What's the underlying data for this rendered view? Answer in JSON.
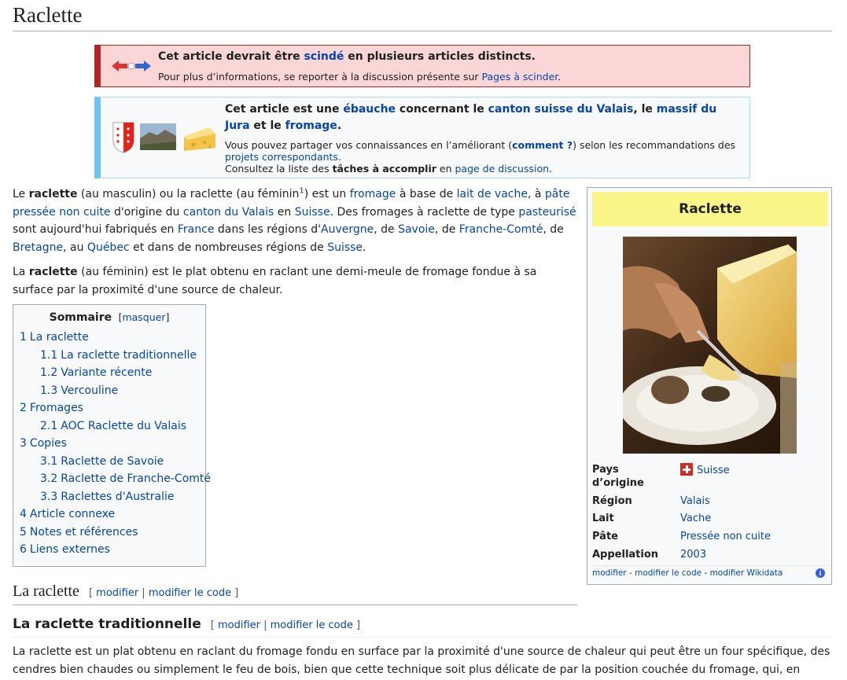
{
  "page": {
    "title": "Raclette"
  },
  "split_banner": {
    "title_pre": "Cet article devrait être ",
    "title_link": "scindé",
    "title_post": " en plusieurs articles distincts.",
    "info_pre": "Pour plus d’informations, se reporter à la discussion présente sur ",
    "info_link": "Pages à scinder",
    "info_post": "."
  },
  "stub_banner": {
    "h_pre": "Cet article est une ",
    "h_link1": "ébauche",
    "h_mid1": " concernant le ",
    "h_link2": "canton suisse du Valais",
    "h_mid2": ", le ",
    "h_link3": "massif du Jura",
    "h_mid3": " et le ",
    "h_link4": "fromage",
    "h_post": ".",
    "s1_pre": "Vous pouvez partager vos connaissances en l’améliorant (",
    "s1_link": "comment ?",
    "s1_post": ") selon les recommandations des ",
    "s1_link2": "projets correspondants",
    "s1_end": ".",
    "s2_pre": "Consultez la liste des ",
    "s2_bold": "tâches à accomplir",
    "s2_mid": " en ",
    "s2_link": "page de discussion",
    "s2_post": "."
  },
  "intro": {
    "p1": [
      {
        "t": "Le "
      },
      {
        "t": "raclette",
        "b": true
      },
      {
        "t": " (au masculin) ou la raclette (au féminin"
      },
      {
        "t": "1",
        "sup": true
      },
      {
        "t": ") est un "
      },
      {
        "t": "fromage",
        "a": true
      },
      {
        "t": " à base de "
      },
      {
        "t": "lait de vache",
        "a": true
      },
      {
        "t": ", à "
      },
      {
        "t": "pâte pressée non cuite",
        "a": true
      },
      {
        "t": " d'origine du "
      },
      {
        "t": "canton du Valais",
        "a": true
      },
      {
        "t": " en "
      },
      {
        "t": "Suisse",
        "a": true
      },
      {
        "t": ". Des fromages à raclette de type "
      },
      {
        "t": "pasteurisé",
        "a": true
      },
      {
        "t": " sont aujourd'hui fabriqués en "
      },
      {
        "t": "France",
        "a": true
      },
      {
        "t": " dans les régions d'"
      },
      {
        "t": "Auvergne",
        "a": true
      },
      {
        "t": ", de "
      },
      {
        "t": "Savoie",
        "a": true
      },
      {
        "t": ", de "
      },
      {
        "t": "Franche-Comté",
        "a": true
      },
      {
        "t": ", de "
      },
      {
        "t": "Bretagne",
        "a": true
      },
      {
        "t": ", au "
      },
      {
        "t": "Québec",
        "a": true
      },
      {
        "t": " et dans de nombreuses régions de "
      },
      {
        "t": "Suisse",
        "a": true
      },
      {
        "t": "."
      }
    ],
    "p2": [
      {
        "t": "La "
      },
      {
        "t": "raclette",
        "b": true
      },
      {
        "t": " (au féminin) est le plat obtenu en raclant une demi-meule de fromage fondue à sa surface par la proximité d'une source de chaleur."
      }
    ]
  },
  "toc": {
    "title": "Sommaire",
    "hide": "masquer",
    "items": [
      {
        "num": "1",
        "label": "La raclette",
        "level": 1
      },
      {
        "num": "1.1",
        "label": "La raclette traditionnelle",
        "level": 2
      },
      {
        "num": "1.2",
        "label": "Variante récente",
        "level": 2
      },
      {
        "num": "1.3",
        "label": "Vercouline",
        "level": 2
      },
      {
        "num": "2",
        "label": "Fromages",
        "level": 1
      },
      {
        "num": "2.1",
        "label": "AOC Raclette du Valais",
        "level": 2
      },
      {
        "num": "3",
        "label": "Copies",
        "level": 1
      },
      {
        "num": "3.1",
        "label": "Raclette de Savoie",
        "level": 2
      },
      {
        "num": "3.2",
        "label": "Raclette de Franche-Comté",
        "level": 2
      },
      {
        "num": "3.3",
        "label": "Raclettes d'Australie",
        "level": 2
      },
      {
        "num": "4",
        "label": "Article connexe",
        "level": 1
      },
      {
        "num": "5",
        "label": "Notes et références",
        "level": 1
      },
      {
        "num": "6",
        "label": "Liens externes",
        "level": 1
      }
    ]
  },
  "infobox": {
    "title": "Raclette",
    "rows": [
      {
        "key_l1": "Pays",
        "key_l2": "d’origine",
        "value": "Suisse"
      },
      {
        "key": "Région",
        "value": "Valais"
      },
      {
        "key": "Lait",
        "value": "Vache"
      },
      {
        "key": "Pâte",
        "value": "Pressée non cuite"
      },
      {
        "key": "Appellation",
        "value": "2003"
      }
    ],
    "footer": {
      "modifier": "modifier",
      "sep": " - ",
      "modifier_code": "modifier le code",
      "modifier_wikidata": "modifier Wikidata",
      "info": "i"
    }
  },
  "section_h2": {
    "title": "La raclette",
    "edit_open": "[ ",
    "edit1": "modifier",
    "edit_sep": " | ",
    "edit2": "modifier le code",
    "edit_close": " ]"
  },
  "section_h3": {
    "title": "La raclette traditionnelle",
    "edit_open": "[ ",
    "edit1": "modifier",
    "edit_sep": " | ",
    "edit2": "modifier le code",
    "edit_close": " ]"
  },
  "trad_paragraph": "La raclette est un plat obtenu en raclant du fromage fondu en surface par la proximité d'une source de chaleur qui peut être un four spécifique, des cendres bien chaudes ou simplement le feu de bois, bien que cette technique soit plus délicate de par la position couchée du fromage, qui, en"
}
